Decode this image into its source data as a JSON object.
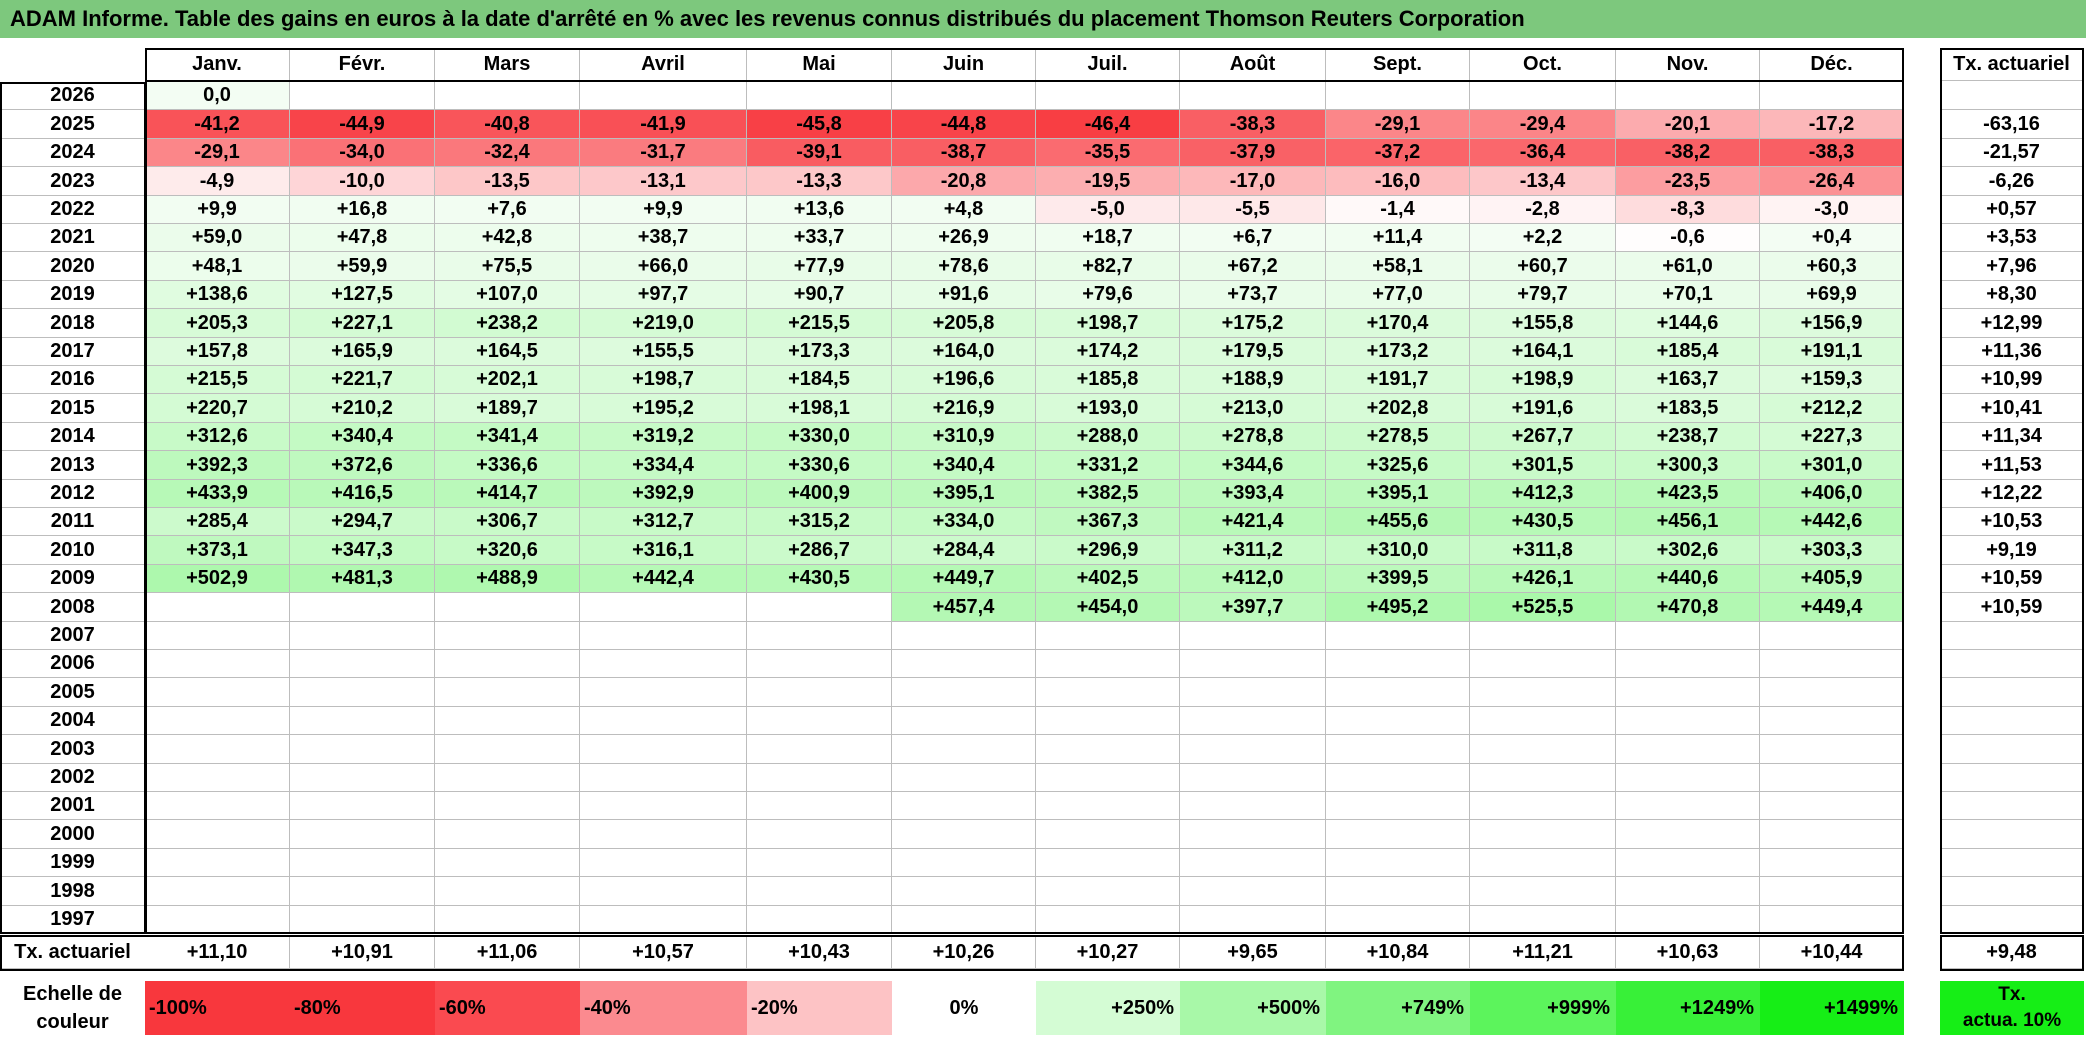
{
  "title": "ADAM Informe. Table des gains en euros à la date d'arrêté en % avec les revenus connus distribués du placement Thomson Reuters Corporation",
  "chart_data": {
    "type": "table",
    "columns": [
      "Janv.",
      "Févr.",
      "Mars",
      "Avril",
      "Mai",
      "Juin",
      "Juil.",
      "Août",
      "Sept.",
      "Oct.",
      "Nov.",
      "Déc."
    ],
    "rate_column_header": "Tx. actuariel",
    "rows": [
      {
        "year": "2026",
        "values": [
          "0,0",
          "",
          "",
          "",
          "",
          "",
          "",
          "",
          "",
          "",
          "",
          ""
        ],
        "rate": ""
      },
      {
        "year": "2025",
        "values": [
          "-41,2",
          "-44,9",
          "-40,8",
          "-41,9",
          "-45,8",
          "-44,8",
          "-46,4",
          "-38,3",
          "-29,1",
          "-29,4",
          "-20,1",
          "-17,2"
        ],
        "rate": "-63,16"
      },
      {
        "year": "2024",
        "values": [
          "-29,1",
          "-34,0",
          "-32,4",
          "-31,7",
          "-39,1",
          "-38,7",
          "-35,5",
          "-37,9",
          "-37,2",
          "-36,4",
          "-38,2",
          "-38,3"
        ],
        "rate": "-21,57"
      },
      {
        "year": "2023",
        "values": [
          "-4,9",
          "-10,0",
          "-13,5",
          "-13,1",
          "-13,3",
          "-20,8",
          "-19,5",
          "-17,0",
          "-16,0",
          "-13,4",
          "-23,5",
          "-26,4"
        ],
        "rate": "-6,26"
      },
      {
        "year": "2022",
        "values": [
          "+9,9",
          "+16,8",
          "+7,6",
          "+9,9",
          "+13,6",
          "+4,8",
          "-5,0",
          "-5,5",
          "-1,4",
          "-2,8",
          "-8,3",
          "-3,0"
        ],
        "rate": "+0,57"
      },
      {
        "year": "2021",
        "values": [
          "+59,0",
          "+47,8",
          "+42,8",
          "+38,7",
          "+33,7",
          "+26,9",
          "+18,7",
          "+6,7",
          "+11,4",
          "+2,2",
          "-0,6",
          "+0,4"
        ],
        "rate": "+3,53"
      },
      {
        "year": "2020",
        "values": [
          "+48,1",
          "+59,9",
          "+75,5",
          "+66,0",
          "+77,9",
          "+78,6",
          "+82,7",
          "+67,2",
          "+58,1",
          "+60,7",
          "+61,0",
          "+60,3"
        ],
        "rate": "+7,96"
      },
      {
        "year": "2019",
        "values": [
          "+138,6",
          "+127,5",
          "+107,0",
          "+97,7",
          "+90,7",
          "+91,6",
          "+79,6",
          "+73,7",
          "+77,0",
          "+79,7",
          "+70,1",
          "+69,9"
        ],
        "rate": "+8,30"
      },
      {
        "year": "2018",
        "values": [
          "+205,3",
          "+227,1",
          "+238,2",
          "+219,0",
          "+215,5",
          "+205,8",
          "+198,7",
          "+175,2",
          "+170,4",
          "+155,8",
          "+144,6",
          "+156,9"
        ],
        "rate": "+12,99"
      },
      {
        "year": "2017",
        "values": [
          "+157,8",
          "+165,9",
          "+164,5",
          "+155,5",
          "+173,3",
          "+164,0",
          "+174,2",
          "+179,5",
          "+173,2",
          "+164,1",
          "+185,4",
          "+191,1"
        ],
        "rate": "+11,36"
      },
      {
        "year": "2016",
        "values": [
          "+215,5",
          "+221,7",
          "+202,1",
          "+198,7",
          "+184,5",
          "+196,6",
          "+185,8",
          "+188,9",
          "+191,7",
          "+198,9",
          "+163,7",
          "+159,3"
        ],
        "rate": "+10,99"
      },
      {
        "year": "2015",
        "values": [
          "+220,7",
          "+210,2",
          "+189,7",
          "+195,2",
          "+198,1",
          "+216,9",
          "+193,0",
          "+213,0",
          "+202,8",
          "+191,6",
          "+183,5",
          "+212,2"
        ],
        "rate": "+10,41"
      },
      {
        "year": "2014",
        "values": [
          "+312,6",
          "+340,4",
          "+341,4",
          "+319,2",
          "+330,0",
          "+310,9",
          "+288,0",
          "+278,8",
          "+278,5",
          "+267,7",
          "+238,7",
          "+227,3"
        ],
        "rate": "+11,34"
      },
      {
        "year": "2013",
        "values": [
          "+392,3",
          "+372,6",
          "+336,6",
          "+334,4",
          "+330,6",
          "+340,4",
          "+331,2",
          "+344,6",
          "+325,6",
          "+301,5",
          "+300,3",
          "+301,0"
        ],
        "rate": "+11,53"
      },
      {
        "year": "2012",
        "values": [
          "+433,9",
          "+416,5",
          "+414,7",
          "+392,9",
          "+400,9",
          "+395,1",
          "+382,5",
          "+393,4",
          "+395,1",
          "+412,3",
          "+423,5",
          "+406,0"
        ],
        "rate": "+12,22"
      },
      {
        "year": "2011",
        "values": [
          "+285,4",
          "+294,7",
          "+306,7",
          "+312,7",
          "+315,2",
          "+334,0",
          "+367,3",
          "+421,4",
          "+455,6",
          "+430,5",
          "+456,1",
          "+442,6"
        ],
        "rate": "+10,53"
      },
      {
        "year": "2010",
        "values": [
          "+373,1",
          "+347,3",
          "+320,6",
          "+316,1",
          "+286,7",
          "+284,4",
          "+296,9",
          "+311,2",
          "+310,0",
          "+311,8",
          "+302,6",
          "+303,3"
        ],
        "rate": "+9,19"
      },
      {
        "year": "2009",
        "values": [
          "+502,9",
          "+481,3",
          "+488,9",
          "+442,4",
          "+430,5",
          "+449,7",
          "+402,5",
          "+412,0",
          "+399,5",
          "+426,1",
          "+440,6",
          "+405,9"
        ],
        "rate": "+10,59"
      },
      {
        "year": "2008",
        "values": [
          "",
          "",
          "",
          "",
          "",
          "+457,4",
          "+454,0",
          "+397,7",
          "+495,2",
          "+525,5",
          "+470,8",
          "+449,4"
        ],
        "rate": "+10,59"
      },
      {
        "year": "2007",
        "values": [
          "",
          "",
          "",
          "",
          "",
          "",
          "",
          "",
          "",
          "",
          "",
          ""
        ],
        "rate": ""
      },
      {
        "year": "2006",
        "values": [
          "",
          "",
          "",
          "",
          "",
          "",
          "",
          "",
          "",
          "",
          "",
          ""
        ],
        "rate": ""
      },
      {
        "year": "2005",
        "values": [
          "",
          "",
          "",
          "",
          "",
          "",
          "",
          "",
          "",
          "",
          "",
          ""
        ],
        "rate": ""
      },
      {
        "year": "2004",
        "values": [
          "",
          "",
          "",
          "",
          "",
          "",
          "",
          "",
          "",
          "",
          "",
          ""
        ],
        "rate": ""
      },
      {
        "year": "2003",
        "values": [
          "",
          "",
          "",
          "",
          "",
          "",
          "",
          "",
          "",
          "",
          "",
          ""
        ],
        "rate": ""
      },
      {
        "year": "2002",
        "values": [
          "",
          "",
          "",
          "",
          "",
          "",
          "",
          "",
          "",
          "",
          "",
          ""
        ],
        "rate": ""
      },
      {
        "year": "2001",
        "values": [
          "",
          "",
          "",
          "",
          "",
          "",
          "",
          "",
          "",
          "",
          "",
          ""
        ],
        "rate": ""
      },
      {
        "year": "2000",
        "values": [
          "",
          "",
          "",
          "",
          "",
          "",
          "",
          "",
          "",
          "",
          "",
          ""
        ],
        "rate": ""
      },
      {
        "year": "1999",
        "values": [
          "",
          "",
          "",
          "",
          "",
          "",
          "",
          "",
          "",
          "",
          "",
          ""
        ],
        "rate": ""
      },
      {
        "year": "1998",
        "values": [
          "",
          "",
          "",
          "",
          "",
          "",
          "",
          "",
          "",
          "",
          "",
          ""
        ],
        "rate": ""
      },
      {
        "year": "1997",
        "values": [
          "",
          "",
          "",
          "",
          "",
          "",
          "",
          "",
          "",
          "",
          "",
          ""
        ],
        "rate": ""
      }
    ],
    "footer": {
      "label": "Tx. actuariel",
      "values": [
        "+11,10",
        "+10,91",
        "+11,06",
        "+10,57",
        "+10,43",
        "+10,26",
        "+10,27",
        "+9,65",
        "+10,84",
        "+11,21",
        "+10,63",
        "+10,44"
      ],
      "rate": "+9,48"
    },
    "legend": {
      "label": [
        "Echelle de",
        "couleur"
      ],
      "steps": [
        {
          "label": "-100%",
          "value": -100,
          "color": "#f8373d"
        },
        {
          "label": "-80%",
          "value": -80,
          "color": "#f8373d"
        },
        {
          "label": "-60%",
          "value": -60,
          "color": "#fa4a50"
        },
        {
          "label": "-40%",
          "value": -40,
          "color": "#fb8a8f"
        },
        {
          "label": "-20%",
          "value": -20,
          "color": "#fdc3c5"
        },
        {
          "label": "0%",
          "value": 0,
          "color": "#ffffff"
        },
        {
          "label": "+250%",
          "value": 250,
          "color": "#d4fcd4"
        },
        {
          "label": "+500%",
          "value": 500,
          "color": "#a8f8a8"
        },
        {
          "label": "+749%",
          "value": 749,
          "color": "#80f480"
        },
        {
          "label": "+999%",
          "value": 999,
          "color": "#5cf45c"
        },
        {
          "label": "+1249%",
          "value": 1249,
          "color": "#38f038"
        },
        {
          "label": "+1499%",
          "value": 1499,
          "color": "#16ee16"
        }
      ],
      "rate_label": [
        "Tx.",
        "actua. 10%"
      ],
      "rate_color": "#16ee16"
    }
  },
  "colors": {
    "title_bar": "#7dc87d",
    "negative_strong": "#f8373d",
    "positive_light": "#f3fdf3"
  }
}
